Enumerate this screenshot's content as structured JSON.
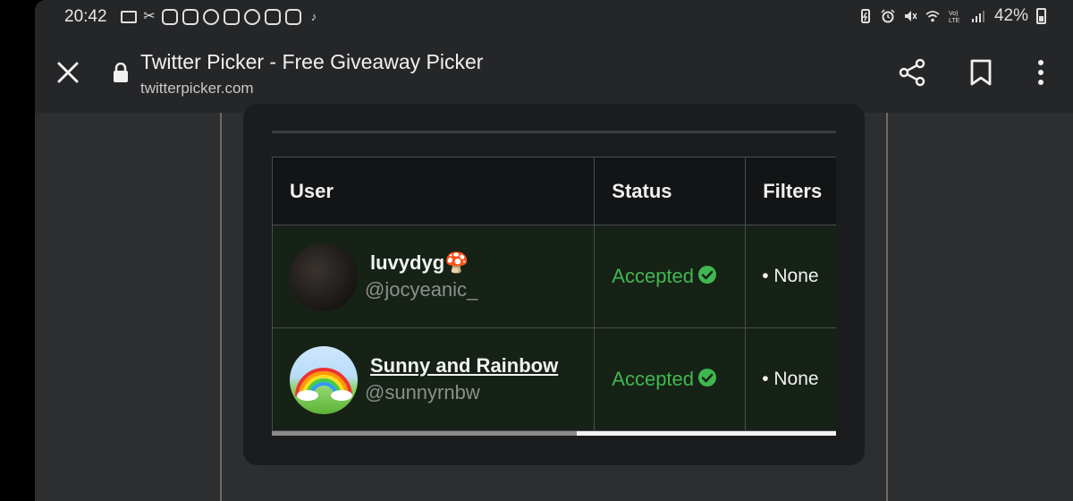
{
  "status_bar": {
    "time": "20:42",
    "notification_icons": [
      "mail-icon",
      "capcut-icon",
      "instagram-icon",
      "instagram-icon",
      "whatsapp-icon",
      "instagram-icon",
      "whatsapp-icon",
      "instagram-icon",
      "instagram-icon",
      "tiktok-icon"
    ],
    "battery_percent": "42%"
  },
  "toolbar": {
    "title": "Twitter Picker - Free Giveaway Picker",
    "url": "twitterpicker.com"
  },
  "table": {
    "headers": [
      "User",
      "Status",
      "Filters"
    ],
    "rows": [
      {
        "name": "luvydyg🍄",
        "handle": "@jocyeanic_",
        "status": "Accepted",
        "filters": "• None",
        "name_linked": false
      },
      {
        "name": "Sunny and Rainbow",
        "handle": "@sunnyrnbw",
        "status": "Accepted",
        "filters": "• None",
        "name_linked": true
      }
    ],
    "status_color": "#3fb84f",
    "horizontal_scroll_fraction": 0.54
  },
  "colors": {
    "page_bg": "#2d2e30",
    "card_bg": "#1b1c1d",
    "row_bg": "#172217",
    "header_bg": "#131415"
  }
}
